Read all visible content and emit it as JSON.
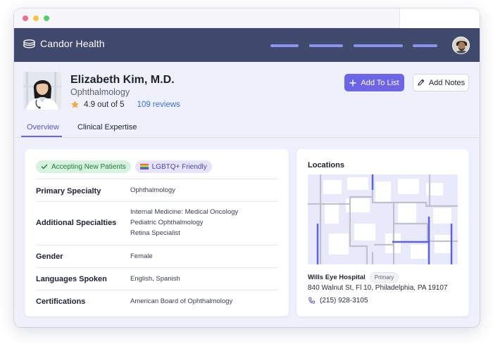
{
  "app": {
    "brand_name": "Candor Health"
  },
  "colors": {
    "appbar": "#404a6d",
    "accent": "#6c65e8",
    "link": "#3b6fe0",
    "nav_pill": "#8a93ee"
  },
  "doctor": {
    "name": "Elizabeth Kim, M.D.",
    "specialty": "Ophthalmology",
    "rating_text": "4.9 out of 5",
    "reviews_text": "109 reviews"
  },
  "actions": {
    "add_to_list": "Add To List",
    "add_notes": "Add Notes"
  },
  "tabs": [
    {
      "label": "Overview",
      "active": true
    },
    {
      "label": "Clinical Expertise",
      "active": false
    }
  ],
  "badges": {
    "accepting": "Accepting New Patients",
    "lgbtq": "LGBTQ+ Friendly"
  },
  "info_rows": [
    {
      "label": "Primary Specialty",
      "values": [
        "Ophthalmology"
      ]
    },
    {
      "label": "Additional Specialties",
      "values": [
        "Internal Medicine: Medical Oncology",
        "Pediatric Ophthalmology",
        "Retina Specialist"
      ]
    },
    {
      "label": "Gender",
      "values": [
        "Female"
      ]
    },
    {
      "label": "Languages Spoken",
      "values": [
        "English, Spanish"
      ]
    },
    {
      "label": "Certifications",
      "values": [
        "American Board of Ophthalmology"
      ]
    }
  ],
  "locations": {
    "title": "Locations",
    "hospital": "Wills Eye Hospital",
    "tag": "Primary",
    "address": "840 Walnut St, Fl 10, Philadelphia, PA 19107",
    "phone": "(215) 928-3105"
  }
}
